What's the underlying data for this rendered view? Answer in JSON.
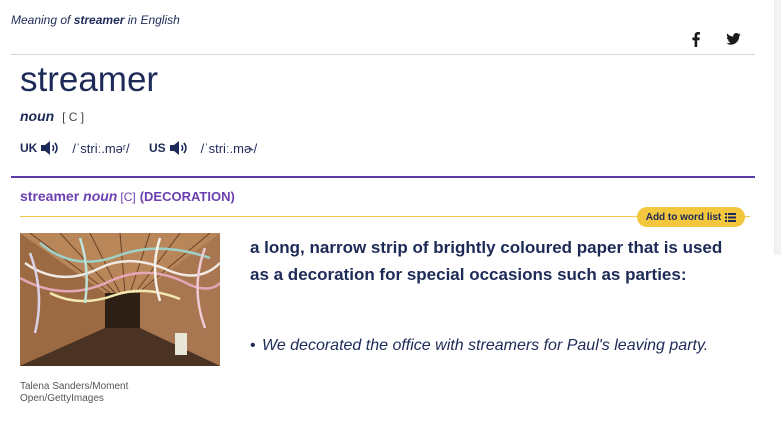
{
  "header": {
    "prefix": "Meaning of",
    "word": "streamer",
    "suffix": "in English"
  },
  "social": [
    "facebook-icon",
    "twitter-icon"
  ],
  "entry": {
    "headword": "streamer",
    "pos": "noun",
    "gram": "[ C ]",
    "uk_label": "UK",
    "uk_ipa": "/ˈstriː.məʳ/",
    "us_label": "US",
    "us_ipa": "/ˈstriː.mɚ/"
  },
  "sense": {
    "word": "streamer",
    "pos": "noun",
    "gram": "[C]",
    "guide": "(DECORATION)",
    "add_button": "Add to word list",
    "definition": "a long, narrow strip of brightly coloured paper that is used as a decoration for special occasions such as parties:",
    "example_bullet": "•",
    "example": "We decorated the office with streamers for Paul's leaving party.",
    "image_credit": "Talena Sanders/Moment Open/GettyImages"
  },
  "colors": {
    "brand_navy": "#1d2a57",
    "sense_purple": "#6b3fb0",
    "button_yellow": "#f2c63d"
  }
}
